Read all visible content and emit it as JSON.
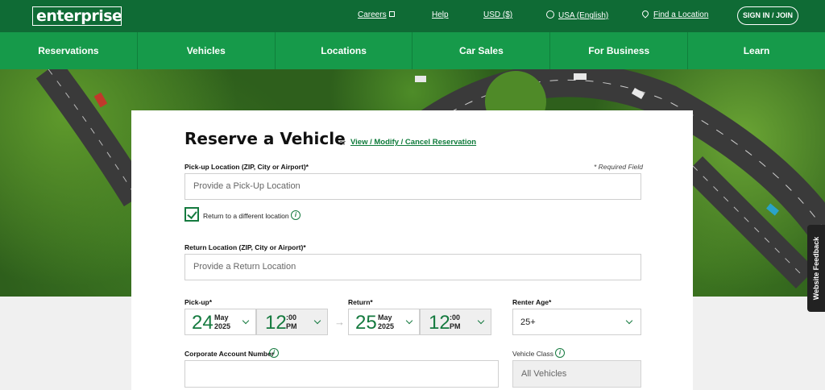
{
  "header": {
    "logo_text": "enterprise",
    "links": {
      "careers": "Careers",
      "help": "Help",
      "currency": "USD ($)",
      "region": "USA (English)",
      "find_location": "Find a Location"
    },
    "sign_in": "SIGN IN / JOIN"
  },
  "nav": [
    "Reservations",
    "Vehicles",
    "Locations",
    "Car Sales",
    "For Business",
    "Learn"
  ],
  "form": {
    "title": "Reserve a Vehicle",
    "or": "or",
    "view_link": "View / Modify / Cancel Reservation",
    "pickup_label": "Pick-up Location (ZIP, City or Airport)*",
    "required_note": "* Required Field",
    "pickup_placeholder": "Provide a Pick-Up Location",
    "return_diff_label": "Return to a different location",
    "return_label": "Return Location (ZIP, City or Airport)*",
    "return_placeholder": "Provide a Return Location",
    "pickup_dt_label": "Pick-up*",
    "return_dt_label": "Return*",
    "age_label": "Renter Age*",
    "pickup": {
      "day": "24",
      "month": "May",
      "year": "2025",
      "hour": "12",
      "minutes": ":00",
      "ampm": "PM"
    },
    "return": {
      "day": "25",
      "month": "May",
      "year": "2025",
      "hour": "12",
      "minutes": ":00",
      "ampm": "PM"
    },
    "age_value": "25+",
    "corporate_label": "Corporate Account Number",
    "vehicle_class_label": "Vehicle Class",
    "vehicle_class_value": "All Vehicles"
  },
  "feedback": "Website Feedback",
  "colors": {
    "dark_green": "#0f6b35",
    "nav_green": "#169a4a",
    "accent_green": "#157a3f"
  },
  "icons": {
    "external": "external-link-icon",
    "globe": "globe-icon",
    "pin": "map-pin-icon",
    "info": "info-icon",
    "chevron": "chevron-down-icon",
    "check": "checkmark-icon",
    "arrow": "arrow-right-icon"
  }
}
